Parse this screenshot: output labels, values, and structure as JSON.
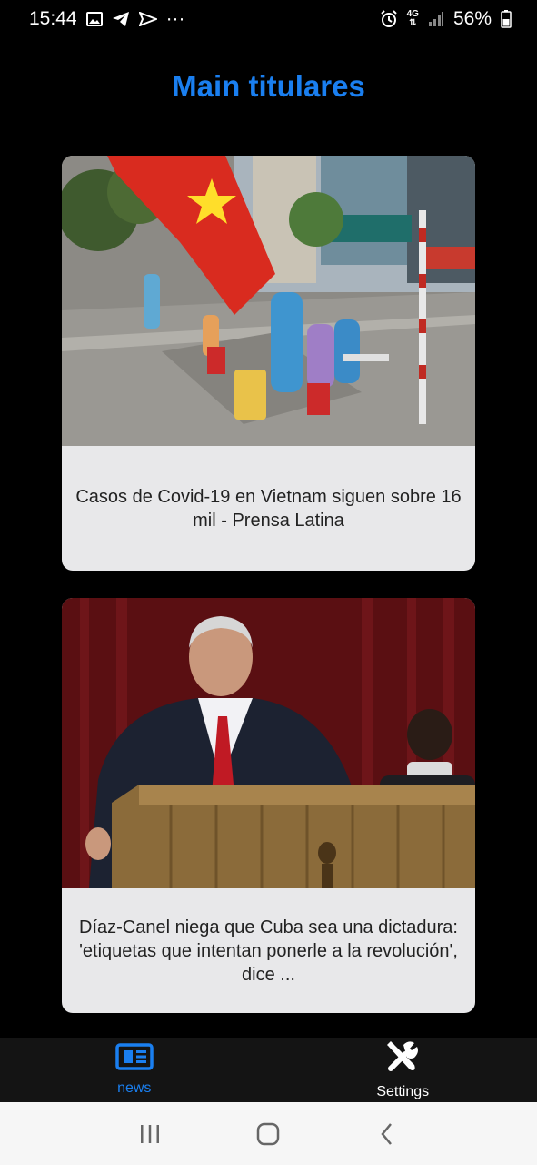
{
  "status_bar": {
    "time": "15:44",
    "more": "···",
    "network": "4G",
    "battery": "56%",
    "icons": [
      "image-icon",
      "telegram-icon",
      "send-icon",
      "alarm-icon",
      "network-4g-icon",
      "signal-icon",
      "battery-icon"
    ]
  },
  "header": {
    "title": "Main titulares"
  },
  "articles": [
    {
      "caption": "Casos de Covid-19 en Vietnam siguen sobre 16 mil - Prensa Latina",
      "image": "vietnam-covid-testing-photo"
    },
    {
      "caption": "Díaz-Canel niega que Cuba sea una dictadura: 'etiquetas que intentan ponerle a la revolución', dice ...",
      "image": "diaz-canel-podium-photo"
    }
  ],
  "bottom_nav": {
    "items": [
      {
        "label": "news",
        "icon": "newspaper-icon",
        "active": true
      },
      {
        "label": "Settings",
        "icon": "tools-icon",
        "active": false
      }
    ]
  },
  "colors": {
    "accent": "#1a7ff0",
    "background": "#000000",
    "card": "#e8e8ea"
  }
}
